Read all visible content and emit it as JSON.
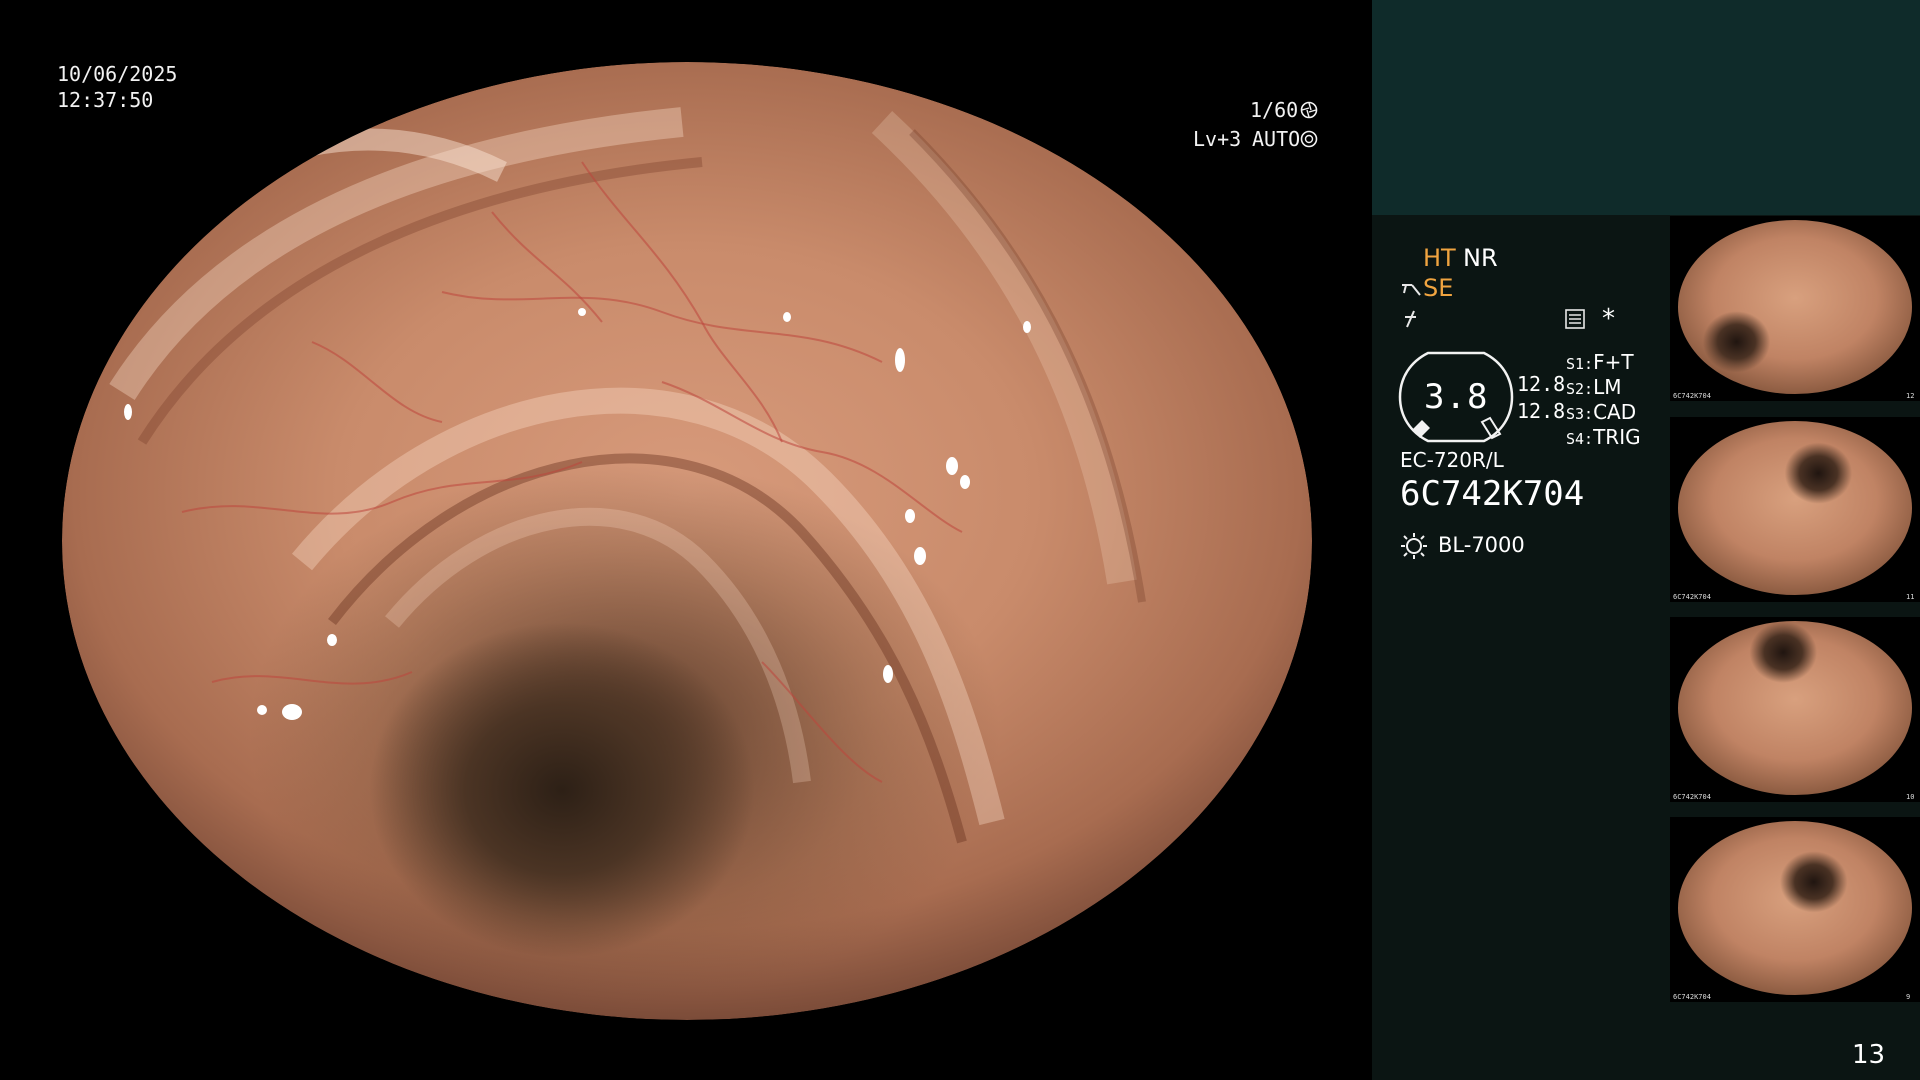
{
  "overlay": {
    "date": "10/06/2025",
    "time": "12:37:50",
    "shutter": "1/60",
    "shutter_icon": "shutter-icon",
    "level": "Lv+3",
    "mode": "AUTO",
    "mode_icon": "iris-icon"
  },
  "status": {
    "ht": "HT",
    "nr": "NR",
    "se": "SE",
    "scope_hook_icon": "scope-hook-icon",
    "lightning_icon": "lightning-icon",
    "settings_icon": "settings-icon",
    "asterisk": "*",
    "gauge_value": "3.8",
    "gauge_right_top": "12.8",
    "gauge_right_bottom": "12.8",
    "switches": [
      {
        "key": "S1:",
        "value": "F+T"
      },
      {
        "key": "S2:",
        "value": "LM"
      },
      {
        "key": "S3:",
        "value": "CAD"
      },
      {
        "key": "S4:",
        "value": "TRIG"
      }
    ],
    "scope_model": "EC-720R/L",
    "serial": "6C742K704",
    "light_icon": "light-source-icon",
    "light_source": "BL-7000"
  },
  "thumbnails": [
    {
      "serial": "6C742K704",
      "index": "12"
    },
    {
      "serial": "6C742K704",
      "index": "11"
    },
    {
      "serial": "6C742K704",
      "index": "10"
    },
    {
      "serial": "6C742K704",
      "index": "9"
    }
  ],
  "page_number": "13",
  "colors": {
    "panel_bg": "#0b1513",
    "header_bg": "#0f2b2a",
    "accent_orange": "#f0a440"
  }
}
